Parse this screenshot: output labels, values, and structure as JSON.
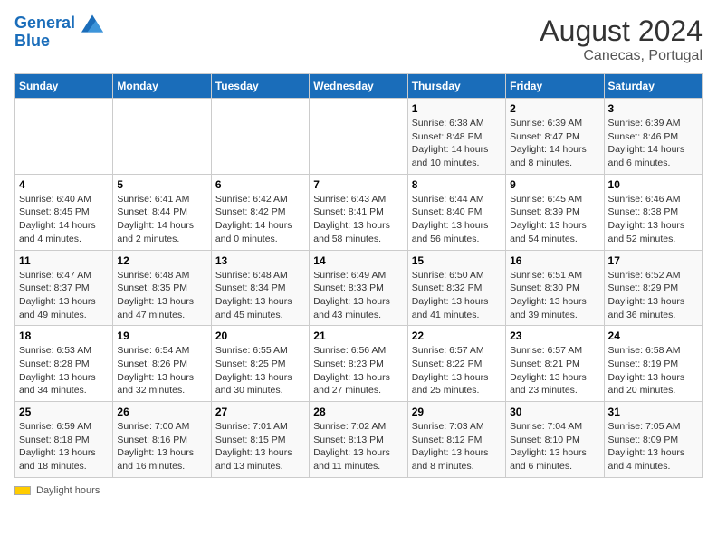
{
  "header": {
    "logo_line1": "General",
    "logo_line2": "Blue",
    "main_title": "August 2024",
    "subtitle": "Canecas, Portugal"
  },
  "days_of_week": [
    "Sunday",
    "Monday",
    "Tuesday",
    "Wednesday",
    "Thursday",
    "Friday",
    "Saturday"
  ],
  "weeks": [
    [
      {
        "day": "",
        "info": ""
      },
      {
        "day": "",
        "info": ""
      },
      {
        "day": "",
        "info": ""
      },
      {
        "day": "",
        "info": ""
      },
      {
        "day": "1",
        "info": "Sunrise: 6:38 AM\nSunset: 8:48 PM\nDaylight: 14 hours\nand 10 minutes."
      },
      {
        "day": "2",
        "info": "Sunrise: 6:39 AM\nSunset: 8:47 PM\nDaylight: 14 hours\nand 8 minutes."
      },
      {
        "day": "3",
        "info": "Sunrise: 6:39 AM\nSunset: 8:46 PM\nDaylight: 14 hours\nand 6 minutes."
      }
    ],
    [
      {
        "day": "4",
        "info": "Sunrise: 6:40 AM\nSunset: 8:45 PM\nDaylight: 14 hours\nand 4 minutes."
      },
      {
        "day": "5",
        "info": "Sunrise: 6:41 AM\nSunset: 8:44 PM\nDaylight: 14 hours\nand 2 minutes."
      },
      {
        "day": "6",
        "info": "Sunrise: 6:42 AM\nSunset: 8:42 PM\nDaylight: 14 hours\nand 0 minutes."
      },
      {
        "day": "7",
        "info": "Sunrise: 6:43 AM\nSunset: 8:41 PM\nDaylight: 13 hours\nand 58 minutes."
      },
      {
        "day": "8",
        "info": "Sunrise: 6:44 AM\nSunset: 8:40 PM\nDaylight: 13 hours\nand 56 minutes."
      },
      {
        "day": "9",
        "info": "Sunrise: 6:45 AM\nSunset: 8:39 PM\nDaylight: 13 hours\nand 54 minutes."
      },
      {
        "day": "10",
        "info": "Sunrise: 6:46 AM\nSunset: 8:38 PM\nDaylight: 13 hours\nand 52 minutes."
      }
    ],
    [
      {
        "day": "11",
        "info": "Sunrise: 6:47 AM\nSunset: 8:37 PM\nDaylight: 13 hours\nand 49 minutes."
      },
      {
        "day": "12",
        "info": "Sunrise: 6:48 AM\nSunset: 8:35 PM\nDaylight: 13 hours\nand 47 minutes."
      },
      {
        "day": "13",
        "info": "Sunrise: 6:48 AM\nSunset: 8:34 PM\nDaylight: 13 hours\nand 45 minutes."
      },
      {
        "day": "14",
        "info": "Sunrise: 6:49 AM\nSunset: 8:33 PM\nDaylight: 13 hours\nand 43 minutes."
      },
      {
        "day": "15",
        "info": "Sunrise: 6:50 AM\nSunset: 8:32 PM\nDaylight: 13 hours\nand 41 minutes."
      },
      {
        "day": "16",
        "info": "Sunrise: 6:51 AM\nSunset: 8:30 PM\nDaylight: 13 hours\nand 39 minutes."
      },
      {
        "day": "17",
        "info": "Sunrise: 6:52 AM\nSunset: 8:29 PM\nDaylight: 13 hours\nand 36 minutes."
      }
    ],
    [
      {
        "day": "18",
        "info": "Sunrise: 6:53 AM\nSunset: 8:28 PM\nDaylight: 13 hours\nand 34 minutes."
      },
      {
        "day": "19",
        "info": "Sunrise: 6:54 AM\nSunset: 8:26 PM\nDaylight: 13 hours\nand 32 minutes."
      },
      {
        "day": "20",
        "info": "Sunrise: 6:55 AM\nSunset: 8:25 PM\nDaylight: 13 hours\nand 30 minutes."
      },
      {
        "day": "21",
        "info": "Sunrise: 6:56 AM\nSunset: 8:23 PM\nDaylight: 13 hours\nand 27 minutes."
      },
      {
        "day": "22",
        "info": "Sunrise: 6:57 AM\nSunset: 8:22 PM\nDaylight: 13 hours\nand 25 minutes."
      },
      {
        "day": "23",
        "info": "Sunrise: 6:57 AM\nSunset: 8:21 PM\nDaylight: 13 hours\nand 23 minutes."
      },
      {
        "day": "24",
        "info": "Sunrise: 6:58 AM\nSunset: 8:19 PM\nDaylight: 13 hours\nand 20 minutes."
      }
    ],
    [
      {
        "day": "25",
        "info": "Sunrise: 6:59 AM\nSunset: 8:18 PM\nDaylight: 13 hours\nand 18 minutes."
      },
      {
        "day": "26",
        "info": "Sunrise: 7:00 AM\nSunset: 8:16 PM\nDaylight: 13 hours\nand 16 minutes."
      },
      {
        "day": "27",
        "info": "Sunrise: 7:01 AM\nSunset: 8:15 PM\nDaylight: 13 hours\nand 13 minutes."
      },
      {
        "day": "28",
        "info": "Sunrise: 7:02 AM\nSunset: 8:13 PM\nDaylight: 13 hours\nand 11 minutes."
      },
      {
        "day": "29",
        "info": "Sunrise: 7:03 AM\nSunset: 8:12 PM\nDaylight: 13 hours\nand 8 minutes."
      },
      {
        "day": "30",
        "info": "Sunrise: 7:04 AM\nSunset: 8:10 PM\nDaylight: 13 hours\nand 6 minutes."
      },
      {
        "day": "31",
        "info": "Sunrise: 7:05 AM\nSunset: 8:09 PM\nDaylight: 13 hours\nand 4 minutes."
      }
    ]
  ],
  "footer": {
    "daylight_label": "Daylight hours"
  }
}
